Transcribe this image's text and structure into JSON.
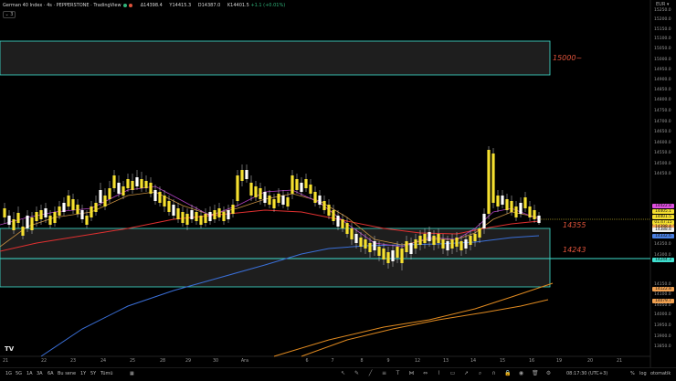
{
  "header": {
    "symbol": "German 40 Index · 4s · PEPPERSTONE · TradingView",
    "open": "Δ14398.4",
    "high": "Y14415.3",
    "low": "D14387.0",
    "close": "K14401.5",
    "change": "+1.1 (+0.01%)",
    "collapse_label": "⌄ 3",
    "status_colors": [
      "#2fb37a",
      "#e0533b"
    ]
  },
  "currency_label": "EUR ▾",
  "zone_labels": {
    "top": "15000~",
    "mid": "14355",
    "low": "14243"
  },
  "price_tags": [
    {
      "text": "14422.8",
      "color": "#e04fe0"
    },
    {
      "text": "14405.1",
      "color": "#f5e030"
    },
    {
      "text": "14401.5",
      "color": "#f5e030"
    },
    {
      "text": "01:47:15",
      "color": "#f5e030"
    },
    {
      "text": "14398.4",
      "color": "#f0a050"
    },
    {
      "text": "14388.8",
      "color": "#f0f0f0"
    },
    {
      "text": "14332.6",
      "color": "#4a7fe0"
    },
    {
      "text": "14244.3",
      "color": "#3fe0d0"
    },
    {
      "text": "14122.8",
      "color": "#f0a050"
    },
    {
      "text": "14079.7",
      "color": "#f0a050"
    }
  ],
  "y_axis_labels": [
    "15250.0",
    "15200.0",
    "15150.0",
    "15100.0",
    "15050.0",
    "15000.0",
    "14950.0",
    "14900.0",
    "14850.0",
    "14800.0",
    "14750.0",
    "14700.0",
    "14650.0",
    "14600.0",
    "14550.0",
    "14500.0",
    "14450.0",
    "14350.0",
    "14300.0",
    "14150.0",
    "14100.0",
    "14050.0",
    "14000.0",
    "13950.0",
    "13900.0",
    "13850.0"
  ],
  "x_axis_labels": [
    "21",
    "22",
    "23",
    "24",
    "25",
    "28",
    "29",
    "30",
    "Ara",
    "6",
    "7",
    "8",
    "9",
    "12",
    "13",
    "14",
    "15",
    "16",
    "19",
    "20",
    "21"
  ],
  "timeframes": [
    "1G",
    "5G",
    "1A",
    "3A",
    "6A",
    "Bu sene",
    "1Y",
    "5Y",
    "Tümü"
  ],
  "tool_icons": [
    "cursor-icon",
    "pencil-icon",
    "line-icon",
    "fib-icon",
    "text-icon",
    "pattern-icon",
    "measure-icon",
    "brush-icon",
    "rect-icon",
    "arrow-icon",
    "zoom-icon",
    "magnet-icon",
    "lock-icon",
    "eye-icon",
    "trash-icon",
    "settings-icon"
  ],
  "footer_right": {
    "time": "08:17:30 (UTC+3)",
    "percent": "%",
    "log": "log",
    "auto": "otomatik"
  },
  "colors": {
    "up_candle": "#f5e030",
    "down_candle": "#ffffff",
    "zone_border": "#3fe0d0",
    "line_red": "#e03030",
    "line_blue": "#3a6fd8",
    "line_orange": "#e08a20",
    "line_purple": "#b040c0"
  }
}
